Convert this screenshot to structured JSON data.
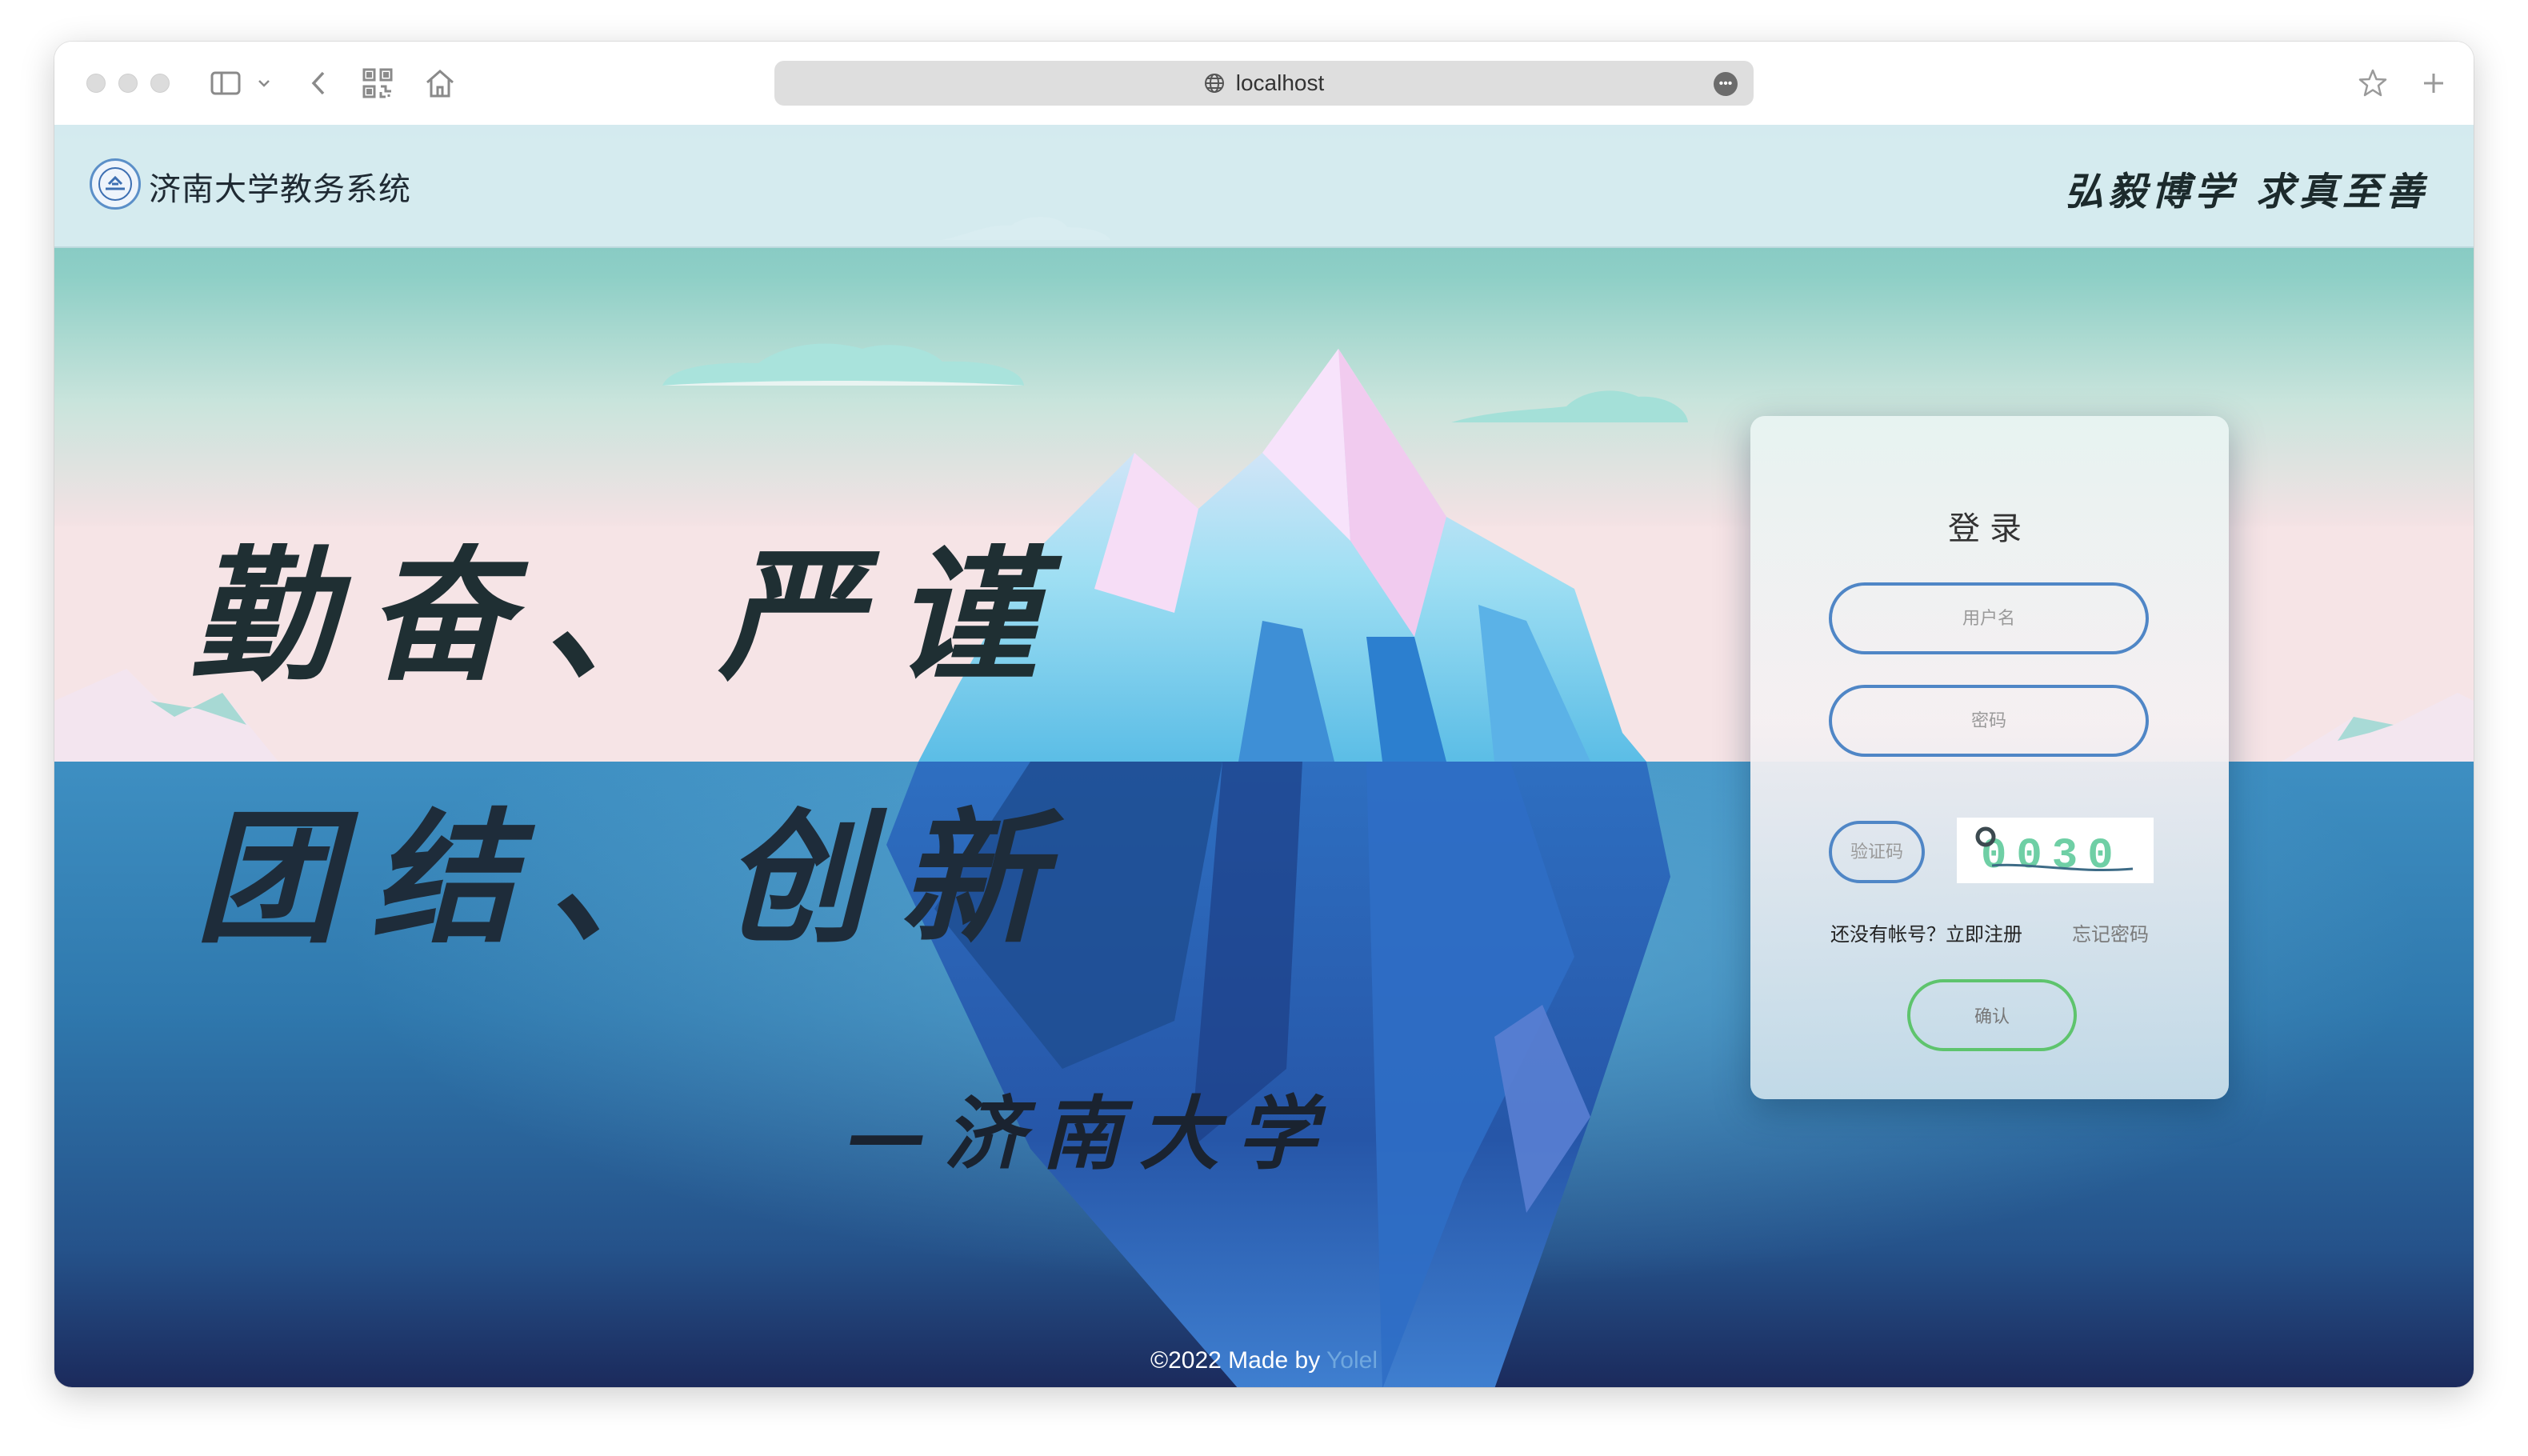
{
  "browser": {
    "url": "localhost"
  },
  "header": {
    "site_title": "济南大学教务系统",
    "motto": "弘毅博学 求真至善"
  },
  "hero": {
    "line1": "勤奋、严谨",
    "line2": "团结、创新",
    "signature": "—济南大学"
  },
  "login": {
    "title": "登录",
    "username_placeholder": "用户名",
    "password_placeholder": "密码",
    "captcha_placeholder": "验证码",
    "captcha_text": "0030",
    "register_text": "还没有帐号？立即注册",
    "forgot_text": "忘记密码",
    "confirm_label": "确认"
  },
  "footer": {
    "prefix": "©2022 Made by ",
    "author": "Yolel"
  },
  "colors": {
    "input_border": "#4f86c6",
    "confirm_border": "#5ec46d",
    "footer_author": "#6fa7de"
  }
}
